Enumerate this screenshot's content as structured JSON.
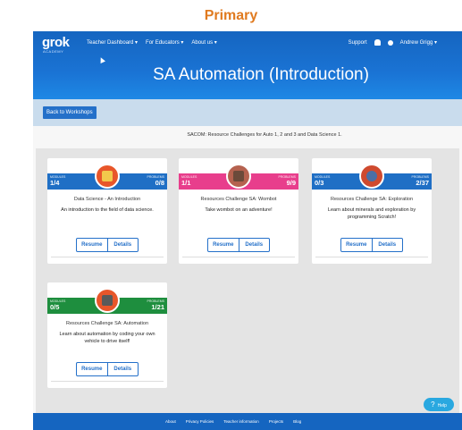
{
  "heading": "Primary",
  "nav": {
    "logo": "grok",
    "logo_sub": "ACADEMY",
    "links": [
      "Teacher Dashboard ▾",
      "For Educators ▾",
      "About us ▾"
    ],
    "support": "Support",
    "user": "Andrew Grigg ▾"
  },
  "page": {
    "title": "SA Automation (Introduction)",
    "back_label": "Back to Workshops",
    "intro": "SACOM: Resource Challenges for Auto 1, 2 and 3 and Data Science 1."
  },
  "card_labels": {
    "modules": "MODULES",
    "problems": "PROBLEMS"
  },
  "cards": [
    {
      "modules": "1/4",
      "problems": "0/8",
      "title": "Data Science - An Introduction",
      "desc": "An introduction to the field of data science.",
      "color": "#1f6fc5",
      "badge_color": "#e8562a",
      "badge_inner": "#f2c94c",
      "resume": "Resume",
      "details": "Details"
    },
    {
      "modules": "1/1",
      "problems": "9/9",
      "title": "Resources Challenge SA: Wombot",
      "desc": "Take wombot on an adventure!",
      "color": "#e83e8c",
      "badge_color": "#b5624f",
      "badge_inner": "#6b4a3a",
      "resume": "Resume",
      "details": "Details"
    },
    {
      "modules": "0/3",
      "problems": "2/37",
      "title": "Resources Challenge SA: Exploration",
      "desc": "Learn about minerals and exploration by programming Scratch!",
      "color": "#1f6fc5",
      "badge_color": "#cf4a2f",
      "badge_inner": "#4a6fa5",
      "resume": "Resume",
      "details": "Details"
    },
    {
      "modules": "0/5",
      "problems": "1/21",
      "title": "Resources Challenge SA: Automation",
      "desc": "Learn about automation by coding your own vehicle to drive itself!",
      "color": "#1e8e3e",
      "badge_color": "#e8562a",
      "badge_inner": "#5a5a5a",
      "resume": "Resume",
      "details": "Details"
    }
  ],
  "footer": {
    "links": [
      "About",
      "Privacy Policies",
      "Teacher information",
      "Projects",
      "Blog"
    ]
  },
  "help": "Help",
  "colors": {
    "nav": "#1565c0",
    "accent": "#2470c9",
    "heading": "#e07a1f"
  }
}
